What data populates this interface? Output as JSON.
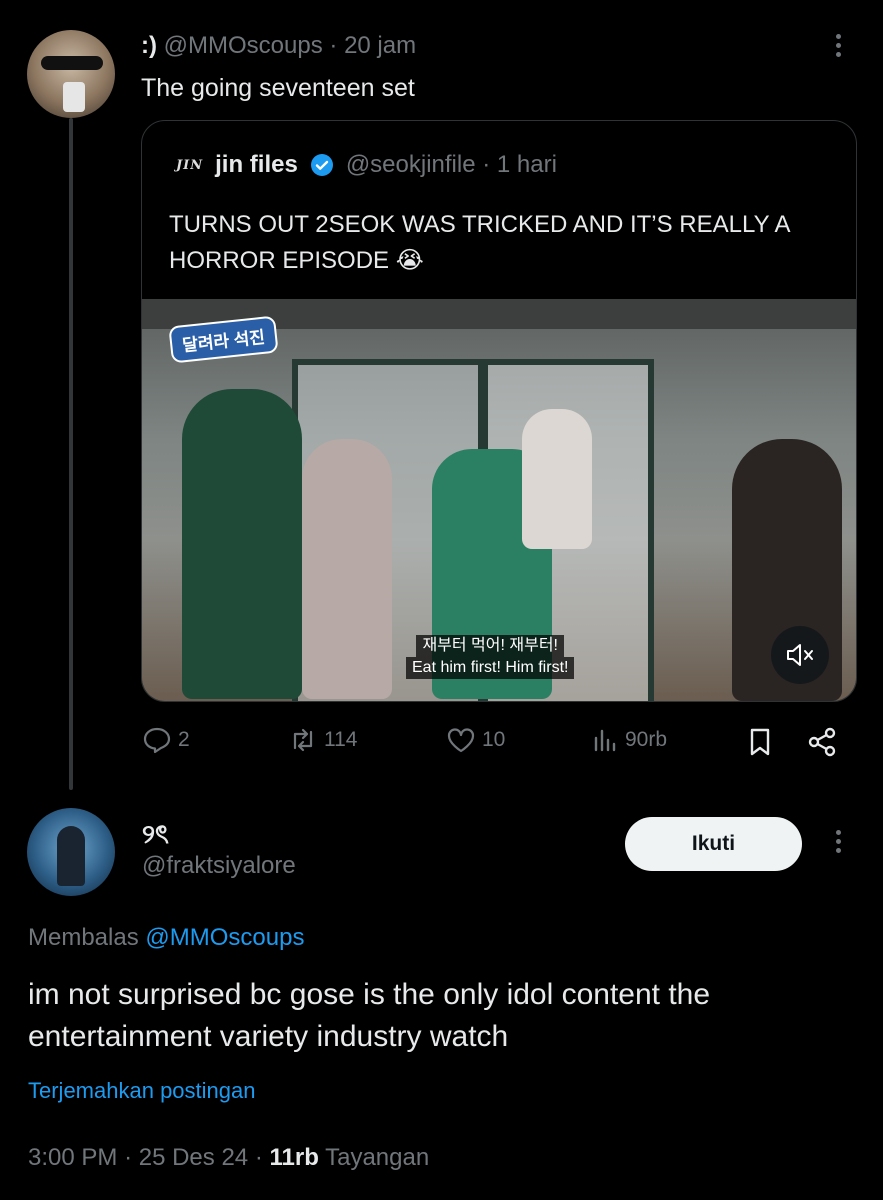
{
  "post": {
    "display_name": ":)",
    "handle": "@MMOscoups",
    "separator": "·",
    "time": "20 jam",
    "text": "The going seventeen set"
  },
  "quote": {
    "logo_text": "JIN",
    "name": "jin files",
    "handle": "@seokjinfile",
    "separator": "·",
    "time": "1 hari",
    "text": "TURNS OUT 2SEOK WAS TRICKED AND IT’S REALLY A HORROR EPISODE 😭",
    "video": {
      "show_logo": "달려라 석진",
      "subtitle_kr": "재부터 먹어! 재부터!",
      "subtitle_en": "Eat him first! Him first!",
      "mute_icon": "speaker-muted-icon"
    }
  },
  "actions": {
    "replies": "2",
    "reposts": "114",
    "likes": "10",
    "views": "90rb"
  },
  "reply": {
    "display_name": "୨ৎ",
    "handle": "@fraktsiyalore",
    "follow_label": "Ikuti",
    "replying_label": "Membalas",
    "replying_to": "@MMOscoups",
    "text": "im not surprised bc gose is the only idol content the entertainment variety industry watch",
    "translate_label": "Terjemahkan postingan",
    "time": "3:00 PM",
    "separator": "·",
    "date": "25 Des 24",
    "views_count": "11rb",
    "views_label": "Tayangan"
  },
  "colors": {
    "background": "#000000",
    "text": "#e7e9ea",
    "muted": "#71767b",
    "link": "#1d9bf0",
    "verified": "#1d9bf0"
  }
}
